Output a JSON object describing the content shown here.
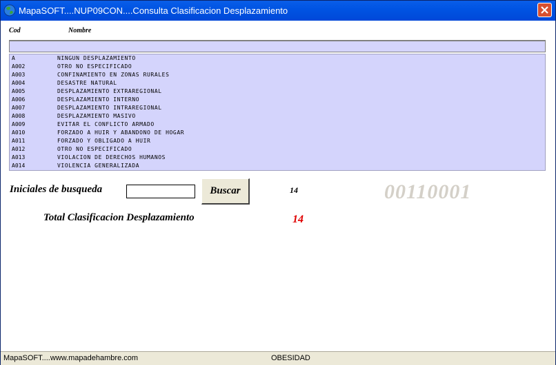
{
  "window": {
    "title": "MapaSOFT....NUP09CON....Consulta  Clasificacion Desplazamiento"
  },
  "columns": {
    "cod": "Cod",
    "nombre": "Nombre"
  },
  "rows": [
    {
      "code": "A",
      "name": "NINGUN DESPLAZAMIENTO"
    },
    {
      "code": "A002",
      "name": "OTRO NO ESPECIFICADO"
    },
    {
      "code": "A003",
      "name": "CONFINAMIENTO EN ZONAS RURALES"
    },
    {
      "code": "A004",
      "name": "DESASTRE NATURAL"
    },
    {
      "code": "A005",
      "name": "DESPLAZAMIENTO EXTRAREGIONAL"
    },
    {
      "code": "A006",
      "name": "DESPLAZAMIENTO INTERNO"
    },
    {
      "code": "A007",
      "name": "DESPLAZAMIENTO INTRAREGIONAL"
    },
    {
      "code": "A008",
      "name": "DESPLAZAMIENTO MASIVO"
    },
    {
      "code": "A009",
      "name": "EVITAR EL CONFLICTO ARMADO"
    },
    {
      "code": "A010",
      "name": "FORZADO A HUIR Y ABANDONO DE HOGAR"
    },
    {
      "code": "A011",
      "name": "FORZADO Y OBLIGADO A HUIR"
    },
    {
      "code": "A012",
      "name": "OTRO NO ESPECIFICADO"
    },
    {
      "code": "A013",
      "name": "VIOLACION DE DERECHOS HUMANOS"
    },
    {
      "code": "A014",
      "name": "VIOLENCIA GENERALIZADA"
    }
  ],
  "search": {
    "label": "Iniciales de busqueda",
    "value": "",
    "button_label": "Buscar"
  },
  "count": "14",
  "record_code": "00110001",
  "total": {
    "label": "Total  Clasificacion Desplazamiento",
    "value": "14"
  },
  "status": {
    "left": "MapaSOFT....www.mapadehambre.com",
    "middle": "OBESIDAD"
  },
  "colors": {
    "list_bg": "#d4d4fc",
    "total_value": "#e00000",
    "title_bar": "#0054e3"
  }
}
